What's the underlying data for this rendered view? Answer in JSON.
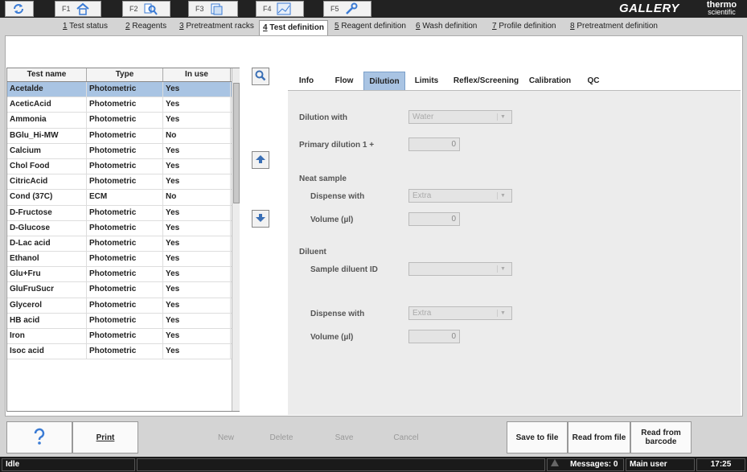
{
  "fkeys": [
    {
      "label": "F1",
      "icon": "home-icon"
    },
    {
      "label": "F2",
      "icon": "search-results-icon"
    },
    {
      "label": "F3",
      "icon": "test-definition-icon"
    },
    {
      "label": "F4",
      "icon": "chart-icon"
    },
    {
      "label": "F5",
      "icon": "wrench-icon"
    }
  ],
  "brand": {
    "name": "GALLERY PLUS",
    "maker_top": "thermo",
    "maker_bottom": "scientific"
  },
  "tabs": [
    {
      "num": "1",
      "label": " Test status"
    },
    {
      "num": "2",
      "label": " Reagents"
    },
    {
      "num": "3",
      "label": " Pretreatment racks"
    },
    {
      "num": "4",
      "label": " Test definition"
    },
    {
      "num": "5",
      "label": " Reagent definition"
    },
    {
      "num": "6",
      "label": " Wash definition"
    },
    {
      "num": "7",
      "label": " Profile definition"
    },
    {
      "num": "8",
      "label": " Pretreatment definition"
    }
  ],
  "table": {
    "headers": [
      "Test name",
      "Type",
      "In use"
    ],
    "rows": [
      [
        "Acetalde",
        "Photometric",
        "Yes"
      ],
      [
        "AceticAcid",
        "Photometric",
        "Yes"
      ],
      [
        "Ammonia",
        "Photometric",
        "Yes"
      ],
      [
        "BGlu_Hi-MW",
        "Photometric",
        "No"
      ],
      [
        "Calcium",
        "Photometric",
        "Yes"
      ],
      [
        "Chol Food",
        "Photometric",
        "Yes"
      ],
      [
        "CitricAcid",
        "Photometric",
        "Yes"
      ],
      [
        "Cond (37C)",
        "ECM",
        "No"
      ],
      [
        "D-Fructose",
        "Photometric",
        "Yes"
      ],
      [
        "D-Glucose",
        "Photometric",
        "Yes"
      ],
      [
        "D-Lac acid",
        "Photometric",
        "Yes"
      ],
      [
        "Ethanol",
        "Photometric",
        "Yes"
      ],
      [
        "Glu+Fru",
        "Photometric",
        "Yes"
      ],
      [
        "GluFruSucr",
        "Photometric",
        "Yes"
      ],
      [
        "Glycerol",
        "Photometric",
        "Yes"
      ],
      [
        "HB acid",
        "Photometric",
        "Yes"
      ],
      [
        "Iron",
        "Photometric",
        "Yes"
      ],
      [
        "Isoc acid",
        "Photometric",
        "Yes"
      ]
    ]
  },
  "detail_tabs": [
    "Info",
    "Flow",
    "Dilution",
    "Limits",
    "Reflex/Screening",
    "Calibration",
    "QC"
  ],
  "dilution": {
    "dilution_with_label": "Dilution with",
    "dilution_with_value": "Water",
    "primary_dilution_label": "Primary dilution 1 +",
    "primary_dilution_value": "0",
    "neat_sample_label": "Neat sample",
    "neat_dispense_label": "Dispense with",
    "neat_dispense_value": "Extra",
    "neat_volume_label": "Volume (µl)",
    "neat_volume_value": "0",
    "diluent_label": "Diluent",
    "sample_diluent_label": "Sample diluent ID",
    "sample_diluent_value": "",
    "diluent_dispense_label": "Dispense with",
    "diluent_dispense_value": "Extra",
    "diluent_volume_label": "Volume (µl)",
    "diluent_volume_value": "0"
  },
  "toolbar": {
    "print": "Print",
    "new": "New",
    "delete": "Delete",
    "save": "Save",
    "cancel": "Cancel",
    "save_to_file": "Save to file",
    "read_from_file": "Read from file",
    "read_from_barcode_1": "Read from",
    "read_from_barcode_2": "barcode"
  },
  "status": {
    "state": "Idle",
    "messages": "Messages: 0",
    "user": "Main user",
    "time": "17:25"
  }
}
